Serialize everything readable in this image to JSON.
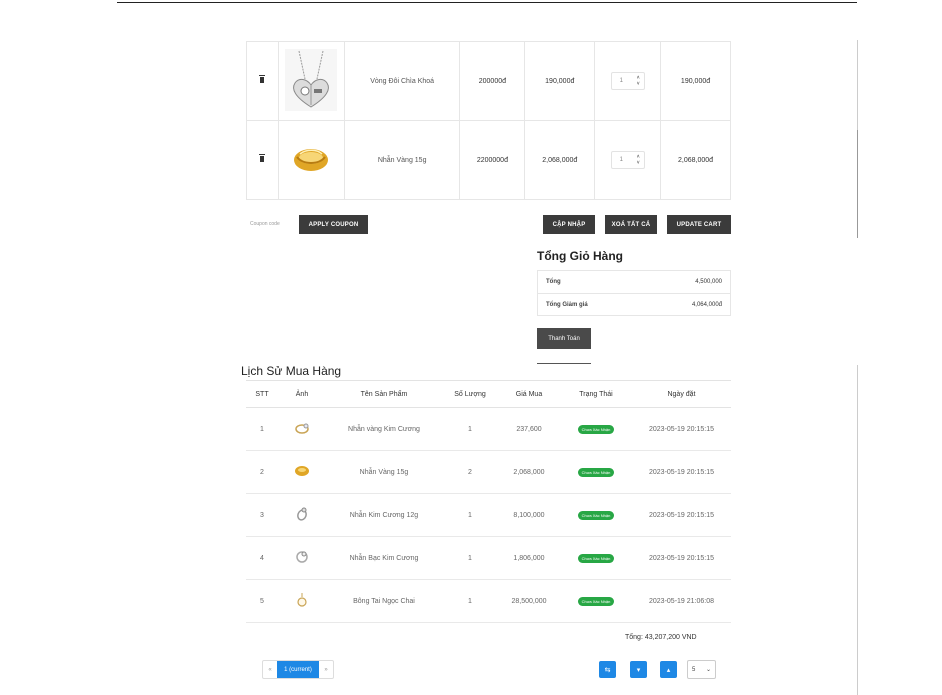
{
  "cart": {
    "items": [
      {
        "name": "Vòng Đôi Chìa Khoá",
        "price": "200000đ",
        "sale_price": "190,000đ",
        "qty": "1",
        "total": "190,000đ",
        "image": "couple-key-necklace-image"
      },
      {
        "name": "Nhẫn Vàng 15g",
        "price": "2200000đ",
        "sale_price": "2,068,000đ",
        "qty": "1",
        "total": "2,068,000đ",
        "image": "gold-ring-image"
      }
    ],
    "coupon_placeholder": "Coupon code",
    "apply_coupon": "APPLY COUPON",
    "update_label": "CẬP NHẬP",
    "clear_all": "XOÁ TẤT CẢ",
    "update_cart": "UPDATE CART"
  },
  "totals": {
    "title": "Tổng Giỏ Hàng",
    "rows": [
      {
        "label": "Tổng",
        "value": "4,500,000"
      },
      {
        "label": "Tổng Giảm giá",
        "value": "4,064,000đ"
      }
    ],
    "checkout": "Thanh Toán"
  },
  "history": {
    "title": "Lịch Sử Mua Hàng",
    "headers": [
      "STT",
      "Ảnh",
      "Tên Sản Phẩm",
      "Số Lượng",
      "Giá Mua",
      "Trạng Thái",
      "Ngày đặt"
    ],
    "rows": [
      {
        "stt": "1",
        "name": "Nhẫn vàng Kim Cương",
        "qty": "1",
        "price": "237,600",
        "status": "Chưa Xác Nhận",
        "date": "2023-05-19 20:15:15"
      },
      {
        "stt": "2",
        "name": "Nhẫn Vàng 15g",
        "qty": "2",
        "price": "2,068,000",
        "status": "Chưa Xác Nhận",
        "date": "2023-05-19 20:15:15"
      },
      {
        "stt": "3",
        "name": "Nhẫn Kim Cương 12g",
        "qty": "1",
        "price": "8,100,000",
        "status": "Chưa Xác Nhận",
        "date": "2023-05-19 20:15:15"
      },
      {
        "stt": "4",
        "name": "Nhẫn Bạc Kim Cương",
        "qty": "1",
        "price": "1,806,000",
        "status": "Chưa Xác Nhận",
        "date": "2023-05-19 20:15:15"
      },
      {
        "stt": "5",
        "name": "Bông Tai Ngọc Chai",
        "qty": "1",
        "price": "28,500,000",
        "status": "Chưa Xác Nhận",
        "date": "2023-05-19 21:06:08"
      }
    ],
    "total": "Tổng: 43,207,200 VND",
    "pager": {
      "prev": "«",
      "current": "1 (current)",
      "next": "»"
    },
    "page_size": "5"
  }
}
